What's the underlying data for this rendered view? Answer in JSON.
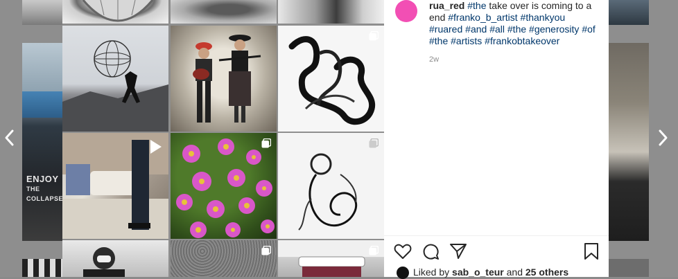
{
  "post": {
    "username": "rua_red",
    "caption_segments": [
      {
        "type": "tag",
        "text": "#the"
      },
      {
        "type": "text",
        "text": " take over is coming to a end "
      },
      {
        "type": "tag",
        "text": "#franko_b_artist"
      },
      {
        "type": "text",
        "text": " "
      },
      {
        "type": "tag",
        "text": "#thankyou"
      },
      {
        "type": "text",
        "text": " "
      },
      {
        "type": "tag",
        "text": "#ruared"
      },
      {
        "type": "text",
        "text": " "
      },
      {
        "type": "tag",
        "text": "#and"
      },
      {
        "type": "text",
        "text": " "
      },
      {
        "type": "tag",
        "text": "#all"
      },
      {
        "type": "text",
        "text": " "
      },
      {
        "type": "tag",
        "text": "#the"
      },
      {
        "type": "text",
        "text": " "
      },
      {
        "type": "tag",
        "text": "#generosity"
      },
      {
        "type": "text",
        "text": " "
      },
      {
        "type": "tag",
        "text": "#of"
      },
      {
        "type": "text",
        "text": " "
      },
      {
        "type": "tag",
        "text": "#the"
      },
      {
        "type": "text",
        "text": " "
      },
      {
        "type": "tag",
        "text": "#artists"
      },
      {
        "type": "text",
        "text": " "
      },
      {
        "type": "tag",
        "text": "#frankobtakeover"
      }
    ],
    "time_ago": "2w",
    "liked_by_prefix": "Liked by ",
    "liked_by_user": "sab_o_teur",
    "liked_by_and": " and ",
    "liked_by_others": "25 others"
  },
  "background_text": {
    "line1": "ENJOY",
    "line2": "THE",
    "line3": "COLLAPSE"
  },
  "icons": {
    "heart": "heart-icon",
    "comment": "comment-icon",
    "share": "send-icon",
    "save": "bookmark-icon",
    "prev": "chevron-left-icon",
    "next": "chevron-right-icon",
    "multi": "carousel-icon",
    "video": "video-icon"
  },
  "colors": {
    "avatar": "#f24fb4",
    "hashtag": "#00376b",
    "text": "#262626",
    "muted": "#8e8e8e"
  }
}
